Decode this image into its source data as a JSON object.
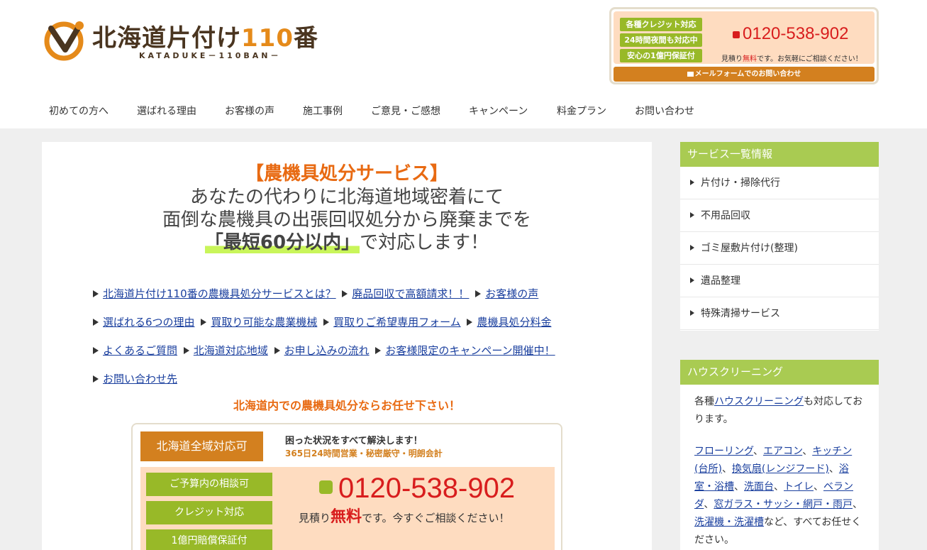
{
  "header": {
    "logo": {
      "title_kanji": "北海道片付け",
      "title_num": "110",
      "title_end": "番",
      "subtitle": "KATADUKE－110BAN－"
    },
    "contact": {
      "badges": [
        "各種クレジット対応",
        "24時間夜間も対応中",
        "安心の1億円保証付"
      ],
      "phone": "0120-538-902",
      "note_pre": "見積り",
      "note_red": "無料",
      "note_post": "です。お気軽にご相談ください！",
      "mail_label": "メールフォームでのお問い合わせ"
    },
    "nav": [
      "初めての方へ",
      "選ばれる理由",
      "お客様の声",
      "施工事例",
      "ご意見・ご感想",
      "キャンペーン",
      "料金プラン",
      "お問い合わせ"
    ]
  },
  "main": {
    "hero": {
      "title": "【農機具処分サービス】",
      "line1": "あなたの代わりに北海道地域密着にて",
      "line2": "面倒な農機具の出張回収処分から廃棄までを",
      "emphasis": "「最短60分以内」",
      "line3_post": "で対応します！"
    },
    "links": [
      [
        "北海道片付け110番の農機具処分サービスとは？",
        "廃品回収で高額請求！！",
        "お客様の声"
      ],
      [
        "選ばれる6つの理由",
        "買取り可能な農業機械",
        "買取りご希望専用フォーム",
        "農機具処分料金"
      ],
      [
        "よくあるご質問",
        "北海道対応地域",
        "お申し込みの流れ",
        "お客様限定のキャンペーン開催中！"
      ],
      [
        "お問い合わせ先"
      ]
    ],
    "tagline": "北海道内での農機具処分ならお任せ下さい！",
    "contact_box": {
      "region": "北海道全域対応可",
      "t1": "困った状況をすべて解決します！",
      "t2": "365日24時間営業・秘密厳守・明朗会計",
      "badges": [
        "ご予算内の相談可",
        "クレジット対応",
        "1億円賠償保証付"
      ],
      "phone": "0120-538-902",
      "note_pre": "見積り",
      "note_red": "無料",
      "note_post": "です。今すぐご相談ください！"
    }
  },
  "sidebar": {
    "services_title": "サービス一覧情報",
    "services": [
      "片付け・掃除代行",
      "不用品回収",
      "ゴミ屋敷片付け(整理)",
      "遺品整理",
      "特殊清掃サービス"
    ],
    "cleaning_title": "ハウスクリーニング",
    "cleaning_p1_pre": "各種",
    "cleaning_p1_link": "ハウスクリーニング",
    "cleaning_p1_post": "も対応しております。",
    "cleaning_links": [
      "フローリング",
      "エアコン",
      "キッチン(台所)",
      "換気扇(レンジフード)",
      "浴室・浴槽",
      "洗面台",
      "トイレ",
      "ベランダ",
      "窓ガラス・サッシ・網戸・雨戸",
      "洗濯機・洗濯槽"
    ],
    "cleaning_p2_post": "など、すべてお任せください。"
  },
  "colors": {
    "accent_orange": "#e86a12",
    "brand_brown": "#d3801f",
    "green": "#98b928",
    "sidebar_green": "#a9cb52",
    "phone_red": "#d81d1d"
  }
}
